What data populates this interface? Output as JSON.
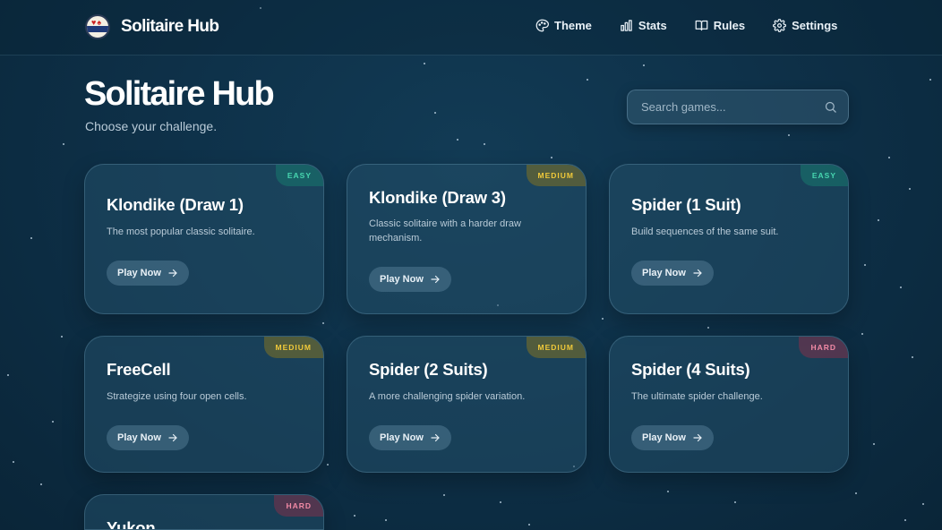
{
  "app": {
    "name": "Solitaire Hub"
  },
  "nav": [
    {
      "label": "Theme",
      "icon": "palette-icon"
    },
    {
      "label": "Stats",
      "icon": "bar-chart-icon"
    },
    {
      "label": "Rules",
      "icon": "book-icon"
    },
    {
      "label": "Settings",
      "icon": "gear-icon"
    }
  ],
  "hero": {
    "title": "Solitaire Hub",
    "subtitle": "Choose your challenge."
  },
  "search": {
    "placeholder": "Search games..."
  },
  "games": [
    {
      "title": "Klondike (Draw 1)",
      "description": "The most popular classic solitaire.",
      "difficulty": "EASY",
      "action": "Play Now"
    },
    {
      "title": "Klondike (Draw 3)",
      "description": "Classic solitaire with a harder draw mechanism.",
      "difficulty": "MEDIUM",
      "action": "Play Now"
    },
    {
      "title": "Spider (1 Suit)",
      "description": "Build sequences of the same suit.",
      "difficulty": "EASY",
      "action": "Play Now"
    },
    {
      "title": "FreeCell",
      "description": "Strategize using four open cells.",
      "difficulty": "MEDIUM",
      "action": "Play Now"
    },
    {
      "title": "Spider (2 Suits)",
      "description": "A more challenging spider variation.",
      "difficulty": "MEDIUM",
      "action": "Play Now"
    },
    {
      "title": "Spider (4 Suits)",
      "description": "The ultimate spider challenge.",
      "difficulty": "HARD",
      "action": "Play Now"
    },
    {
      "title": "Yukon",
      "difficulty": "HARD"
    }
  ],
  "colors": {
    "background": "#0e3149",
    "easy": "#47d6b0",
    "medium": "#f0c93a",
    "hard": "#f28aa6"
  }
}
